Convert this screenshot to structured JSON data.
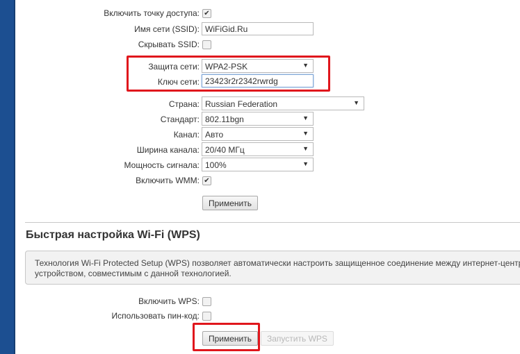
{
  "wifi": {
    "enable_ap": {
      "label": "Включить точку доступа:",
      "checked": true
    },
    "ssid": {
      "label": "Имя сети (SSID):",
      "value": "WiFiGid.Ru"
    },
    "hide_ssid": {
      "label": "Скрывать SSID:",
      "checked": false
    },
    "security": {
      "label": "Защита сети:",
      "value": "WPA2-PSK"
    },
    "key": {
      "label": "Ключ сети:",
      "value": "23423r2r2342rwrdg"
    },
    "country": {
      "label": "Страна:",
      "value": "Russian Federation"
    },
    "standard": {
      "label": "Стандарт:",
      "value": "802.11bgn"
    },
    "channel": {
      "label": "Канал:",
      "value": "Авто"
    },
    "channel_width": {
      "label": "Ширина канала:",
      "value": "20/40 МГц"
    },
    "signal_power": {
      "label": "Мощность сигнала:",
      "value": "100%"
    },
    "wmm": {
      "label": "Включить WMM:",
      "checked": true
    },
    "apply_label": "Применить"
  },
  "wps": {
    "title": "Быстрая настройка Wi-Fi (WPS)",
    "info_line1": "Технология Wi-Fi Protected Setup (WPS) позволяет автоматически настроить защищенное соединение между интернет-центр",
    "info_line2": "устройством, совместимым с данной технологией.",
    "enable": {
      "label": "Включить WPS:",
      "checked": false
    },
    "use_pin": {
      "label": "Использовать пин-код:",
      "checked": false
    },
    "apply_label": "Применить",
    "start_label": "Запустить WPS"
  },
  "icons": {
    "check": "✔",
    "dropdown": "▼"
  },
  "colors": {
    "highlight": "#e0161c",
    "sidebar": "#1c4f91"
  }
}
